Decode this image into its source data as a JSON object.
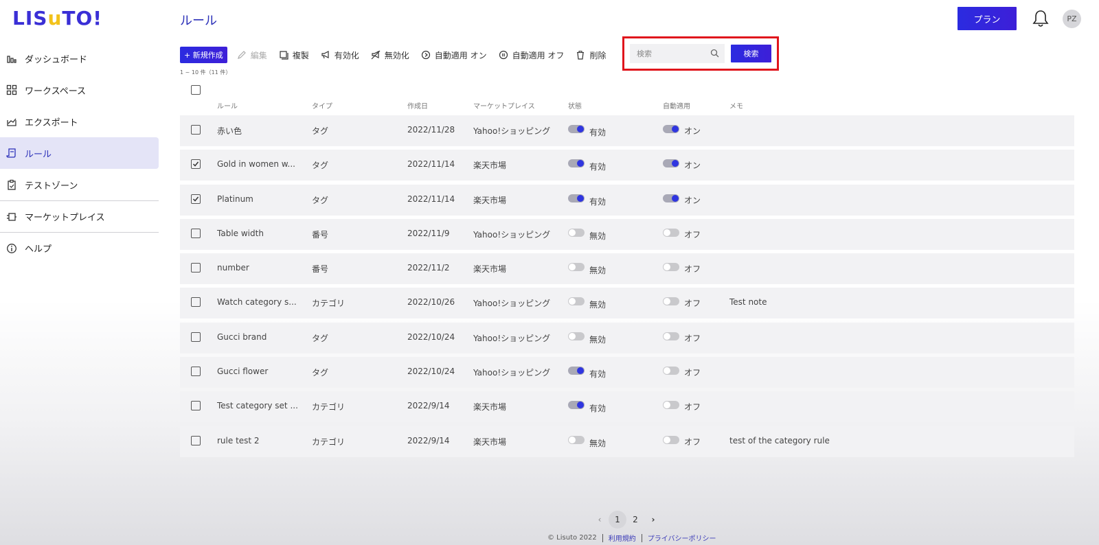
{
  "app": {
    "logo_left": "LIS",
    "logo_u": "u",
    "logo_right": "TO!",
    "page_title": "ルール",
    "plan_label": "プラン",
    "avatar_initials": "PZ"
  },
  "sidebar": {
    "items": [
      {
        "label": "ダッシュボード",
        "icon": "bar-chart-icon"
      },
      {
        "label": "ワークスペース",
        "icon": "grid-icon"
      },
      {
        "label": "エクスポート",
        "icon": "export-icon"
      },
      {
        "label": "ルール",
        "icon": "rule-icon",
        "active": true
      },
      {
        "label": "テストゾーン",
        "icon": "clipboard-icon"
      },
      {
        "label": "マーケットプレイス",
        "icon": "plug-icon"
      },
      {
        "label": "ヘルプ",
        "icon": "info-icon"
      }
    ]
  },
  "toolbar": {
    "new_label": "+ 新規作成",
    "edit_label": "編集",
    "duplicate_label": "複製",
    "enable_label": "有効化",
    "disable_label": "無効化",
    "auto_on_label": "自動適用 オン",
    "auto_off_label": "自動適用 オフ",
    "delete_label": "削除",
    "search_placeholder": "検索",
    "search_button": "検索",
    "count_text": "1 ~ 10 件（11 件）"
  },
  "table": {
    "headers": [
      "ルール",
      "タイプ",
      "作成日",
      "マーケットプレイス",
      "状態",
      "自動適用",
      "メモ"
    ],
    "rows": [
      {
        "checked": false,
        "rule": "赤い色",
        "type": "タグ",
        "date": "2022/11/28",
        "market": "Yahoo!ショッピング",
        "state_on": true,
        "state": "有効",
        "auto_on": true,
        "auto": "オン",
        "memo": ""
      },
      {
        "checked": true,
        "rule": "Gold in women w...",
        "type": "タグ",
        "date": "2022/11/14",
        "market": "楽天市場",
        "state_on": true,
        "state": "有効",
        "auto_on": true,
        "auto": "オン",
        "memo": ""
      },
      {
        "checked": true,
        "rule": "Platinum",
        "type": "タグ",
        "date": "2022/11/14",
        "market": "楽天市場",
        "state_on": true,
        "state": "有効",
        "auto_on": true,
        "auto": "オン",
        "memo": ""
      },
      {
        "checked": false,
        "rule": "Table width",
        "type": "番号",
        "date": "2022/11/9",
        "market": "Yahoo!ショッピング",
        "state_on": false,
        "state": "無効",
        "auto_on": false,
        "auto": "オフ",
        "memo": ""
      },
      {
        "checked": false,
        "rule": "number",
        "type": "番号",
        "date": "2022/11/2",
        "market": "楽天市場",
        "state_on": false,
        "state": "無効",
        "auto_on": false,
        "auto": "オフ",
        "memo": ""
      },
      {
        "checked": false,
        "rule": "Watch category s...",
        "type": "カテゴリ",
        "date": "2022/10/26",
        "market": "Yahoo!ショッピング",
        "state_on": false,
        "state": "無効",
        "auto_on": false,
        "auto": "オフ",
        "memo": "Test note"
      },
      {
        "checked": false,
        "rule": "Gucci brand",
        "type": "タグ",
        "date": "2022/10/24",
        "market": "Yahoo!ショッピング",
        "state_on": false,
        "state": "無効",
        "auto_on": false,
        "auto": "オフ",
        "memo": ""
      },
      {
        "checked": false,
        "rule": "Gucci flower",
        "type": "タグ",
        "date": "2022/10/24",
        "market": "Yahoo!ショッピング",
        "state_on": true,
        "state": "有効",
        "auto_on": false,
        "auto": "オフ",
        "memo": ""
      },
      {
        "checked": false,
        "rule": "Test category set ...",
        "type": "カテゴリ",
        "date": "2022/9/14",
        "market": "楽天市場",
        "state_on": true,
        "state": "有効",
        "auto_on": false,
        "auto": "オフ",
        "memo": ""
      },
      {
        "checked": false,
        "rule": "rule test 2",
        "type": "カテゴリ",
        "date": "2022/9/14",
        "market": "楽天市場",
        "state_on": false,
        "state": "無効",
        "auto_on": false,
        "auto": "オフ",
        "memo": "test of the category rule"
      }
    ]
  },
  "pagination": {
    "prev": "‹",
    "pages": [
      "1",
      "2"
    ],
    "current": "1",
    "next": "›"
  },
  "footer": {
    "copyright": "© Lisuto 2022",
    "terms": "利用規約",
    "privacy": "プライバシーポリシー"
  },
  "colors": {
    "brand": "#3a2fd6",
    "accent_yellow": "#f2c21b",
    "highlight_border": "#e0151c"
  }
}
